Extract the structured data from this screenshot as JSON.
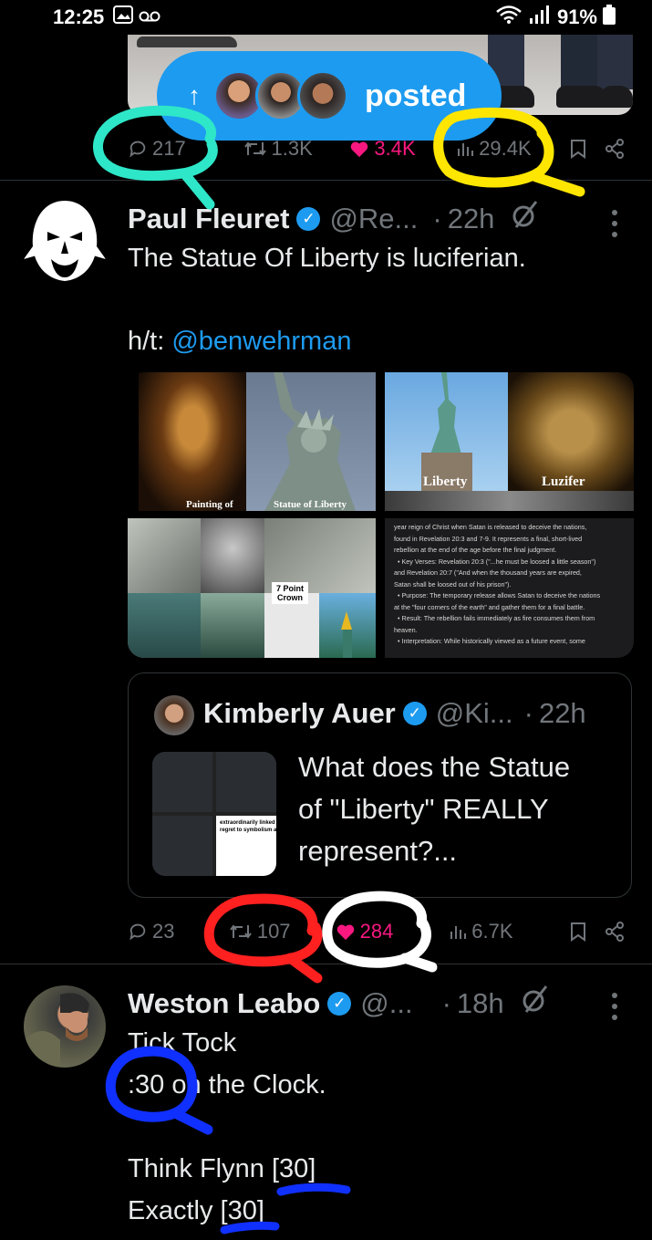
{
  "status_bar": {
    "time": "12:25",
    "battery": "91%",
    "icons": [
      "image-icon",
      "voicemail-icon",
      "wifi-icon",
      "signal-icon",
      "battery-icon"
    ]
  },
  "posted_pill": {
    "label": "posted",
    "avatar_count": 3
  },
  "prev_tweet_actions": {
    "replies": "217",
    "reposts": "1.3K",
    "likes": "3.4K",
    "views": "29.4K"
  },
  "tweet1": {
    "name": "Paul Fleuret",
    "handle": "@Re...",
    "time": "22h",
    "line1": "The Statue Of Liberty is luciferian.",
    "ht_prefix": "h/t: ",
    "ht_mention": "@benwehrman",
    "media_labels": {
      "painting": "Painting of",
      "statue": "Statue of Liberty",
      "liberty": "Liberty",
      "luzifer": "Luzifer",
      "crown": "7 Point\nCrown"
    },
    "media_text_lines": [
      "year reign of Christ when Satan is released to deceive the nations,",
      "found in Revelation 20:3 and 7-9. It represents a final, short-lived",
      "rebellion at the end of the age before the final judgment.",
      "• Key Verses: Revelation 20:3 (\"...he must be loosed a little season\")",
      "and Revelation 20:7 (\"And when the thousand years are expired,",
      "Satan shall be loosed out of his prison\").",
      "• Purpose: The temporary release allows Satan to deceive the nations",
      "at the \"four corners of the earth\" and gather them for a final battle.",
      "• Result: The rebellion fails immediately as fire consumes them from",
      "heaven.",
      "• Interpretation: While historically viewed as a future event, some"
    ],
    "quote": {
      "name": "Kimberly Auer",
      "handle": "@Ki...",
      "time": "22h",
      "text": "What does the Statue\nof \"Liberty\" REALLY\nrepresent?...",
      "thumb_text": "extraordinarily linked to satanic s\nregret to symbolism and history"
    },
    "actions": {
      "replies": "23",
      "reposts": "107",
      "likes": "284",
      "views": "6.7K"
    }
  },
  "tweet2": {
    "name": "Weston Leabo",
    "handle": "@...",
    "time": "18h",
    "text": "Tick Tock\n:30 on the Clock.\n\nThink Flynn [30]\nExactly [30]"
  },
  "annotation_colors": {
    "teal": "#2ee6c8",
    "yellow": "#ffe600",
    "red": "#ff2020",
    "white": "#ffffff",
    "blue": "#1030ff"
  }
}
